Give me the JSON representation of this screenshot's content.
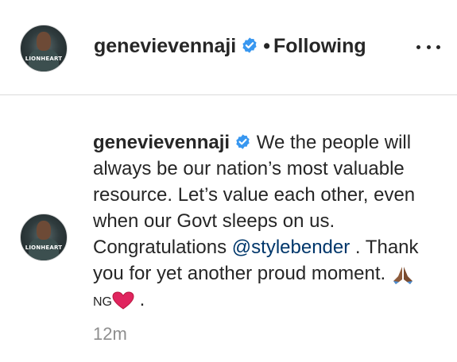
{
  "header": {
    "username": "genevievennaji",
    "separator": "•",
    "follow_status": "Following",
    "avatar_brand": "LIONHEART"
  },
  "comment": {
    "username": "genevievennaji",
    "text_part1": " We the people will always be our nation’s most valuable resource. Let’s value each other, even when our Govt sleeps on us. Congratulations ",
    "mention": "@stylebender",
    "text_part2": " . Thank you for yet another proud moment. ",
    "flag_text": "NG",
    "end_text": " .",
    "timestamp": "12m",
    "avatar_brand": "LIONHEART"
  },
  "icons": {
    "verified": "verified-badge-icon",
    "more": "more-options-icon",
    "pray": "folded-hands-emoji",
    "heart": "red-heart-emoji"
  },
  "colors": {
    "verified_blue": "#3897f0",
    "mention": "#00376b",
    "timestamp": "#8e8e8e",
    "heart": "#e0245e"
  }
}
